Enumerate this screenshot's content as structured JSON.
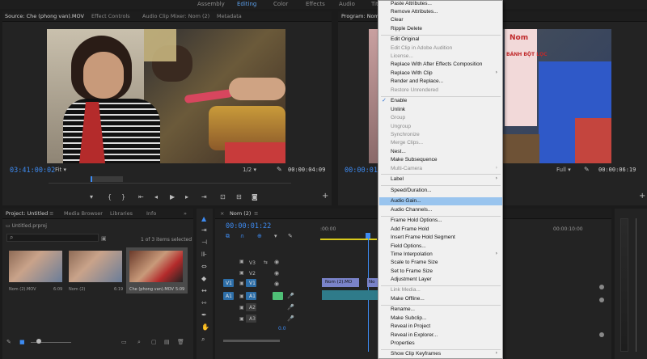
{
  "workspaces": [
    {
      "label": "Assembly",
      "active": false
    },
    {
      "label": "Editing",
      "active": true
    },
    {
      "label": "Color",
      "active": false
    },
    {
      "label": "Effects",
      "active": false
    },
    {
      "label": "Audio",
      "active": false
    },
    {
      "label": "Tit",
      "active": false
    }
  ],
  "source_panel": {
    "tabs": [
      "Source: Che (phong van).MOV",
      "Effect Controls",
      "Audio Clip Mixer: Nom (2)",
      "Metadata"
    ],
    "timecode_in": "03:41:00:02",
    "fit": "Fit",
    "resolution": "1/2",
    "timecode_out": "00:00:04:09"
  },
  "program_panel": {
    "tab": "Program: Nom",
    "timecode_in": "00:00:01:2",
    "resolution": "Full",
    "timecode_out": "00:00:06:19",
    "sign_text_1": "Nom",
    "sign_text_2": "BÁNH BỘT LỌC"
  },
  "project_panel": {
    "tabs": [
      "Project: Untitled",
      "Media Browser",
      "Libraries",
      "Info"
    ],
    "file": "Untitled.prproj",
    "count": "1 of 3 items selected",
    "items": [
      {
        "name": "Nom (2).MOV",
        "duration": "6:09"
      },
      {
        "name": "Nom (2)",
        "duration": "6:19"
      },
      {
        "name": "Che (phong van).MOV",
        "duration": "5:09"
      }
    ]
  },
  "timeline": {
    "tab": "Nom (2)",
    "timecode": "00:00:01:22",
    "ruler_mark": "00:00:10:00",
    "tracks_video": [
      "V3",
      "V2",
      "V1"
    ],
    "tracks_audio": [
      "A1",
      "A2",
      "A3"
    ],
    "src_v": "V1",
    "src_a": "A1",
    "master_value": "0.0",
    "clips": [
      "Nom (2).MO",
      "No"
    ]
  },
  "context_menu": {
    "items": [
      {
        "label": "Paste Attributes...",
        "disabled": false
      },
      {
        "label": "Remove Attributes...",
        "disabled": false
      },
      {
        "label": "Clear",
        "disabled": false
      },
      {
        "label": "Ripple Delete",
        "disabled": false
      },
      {
        "label": "Edit Original",
        "disabled": false
      },
      {
        "label": "Edit Clip in Adobe Audition",
        "disabled": true
      },
      {
        "label": "License...",
        "disabled": true
      },
      {
        "label": "Replace With After Effects Composition",
        "disabled": false
      },
      {
        "label": "Replace With Clip",
        "disabled": false,
        "submenu": true
      },
      {
        "label": "Render and Replace...",
        "disabled": false
      },
      {
        "label": "Restore Unrendered",
        "disabled": true
      },
      {
        "label": "Enable",
        "disabled": false,
        "checked": true
      },
      {
        "label": "Unlink",
        "disabled": false
      },
      {
        "label": "Group",
        "disabled": true
      },
      {
        "label": "Ungroup",
        "disabled": true
      },
      {
        "label": "Synchronize",
        "disabled": true
      },
      {
        "label": "Merge Clips...",
        "disabled": true
      },
      {
        "label": "Nest...",
        "disabled": false
      },
      {
        "label": "Make Subsequence",
        "disabled": false
      },
      {
        "label": "Multi-Camera",
        "disabled": true,
        "submenu": true
      },
      {
        "label": "Label",
        "disabled": false,
        "submenu": true
      },
      {
        "label": "Speed/Duration...",
        "disabled": false
      },
      {
        "label": "Audio Gain...",
        "disabled": false,
        "highlighted": true
      },
      {
        "label": "Audio Channels...",
        "disabled": false
      },
      {
        "label": "Frame Hold Options...",
        "disabled": false
      },
      {
        "label": "Add Frame Hold",
        "disabled": false
      },
      {
        "label": "Insert Frame Hold Segment",
        "disabled": false
      },
      {
        "label": "Field Options...",
        "disabled": false
      },
      {
        "label": "Time Interpolation",
        "disabled": false,
        "submenu": true
      },
      {
        "label": "Scale to Frame Size",
        "disabled": false
      },
      {
        "label": "Set to Frame Size",
        "disabled": false
      },
      {
        "label": "Adjustment Layer",
        "disabled": false
      },
      {
        "label": "Link Media...",
        "disabled": true
      },
      {
        "label": "Make Offline...",
        "disabled": false
      },
      {
        "label": "Rename...",
        "disabled": false
      },
      {
        "label": "Make Subclip...",
        "disabled": false
      },
      {
        "label": "Reveal in Project",
        "disabled": false
      },
      {
        "label": "Reveal in Explorer...",
        "disabled": false
      },
      {
        "label": "Properties",
        "disabled": false
      },
      {
        "label": "Show Clip Keyframes",
        "disabled": false,
        "submenu": true
      }
    ]
  },
  "icons": {
    "checkmark": "✓",
    "submenu_arrow": "›",
    "play": "▶",
    "step_back": "◀|",
    "step_fwd": "|▶",
    "wrench": "🔧",
    "camera": "📷",
    "plus": "+",
    "eye": "👁",
    "lock": "🔒",
    "search": "⌕",
    "folder": "▭"
  },
  "colors": {
    "accent_blue": "#3d8bf2",
    "menu_highlight": "#99c4ee",
    "track_blue": "#2d6ea8",
    "clip_purple": "#7a83c9",
    "mute_green": "#4fbf76"
  }
}
